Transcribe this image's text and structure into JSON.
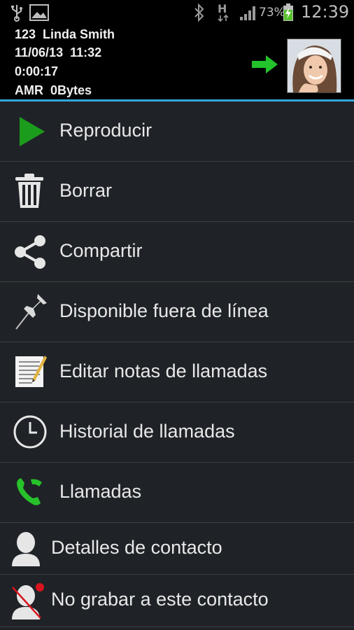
{
  "status_bar": {
    "icons": [
      "usb-icon",
      "gallery-icon",
      "bluetooth-icon",
      "h-data-icon",
      "signal-icon",
      "battery-charging-icon"
    ],
    "data_label": "H",
    "battery_percent": "73%",
    "time": "12:39"
  },
  "header": {
    "line1": "123  Linda Smith",
    "line2": "11/06/13  11:32",
    "line3": "0:00:17",
    "line4": "AMR  0Bytes",
    "arrow_color": "#22c32b"
  },
  "menu": {
    "items": [
      {
        "label": "Reproducir",
        "icon": "play-icon"
      },
      {
        "label": "Borrar",
        "icon": "trash-icon"
      },
      {
        "label": "Compartir",
        "icon": "share-icon"
      },
      {
        "label": "Disponible fuera de línea",
        "icon": "pin-icon"
      },
      {
        "label": "Editar notas de llamadas",
        "icon": "notes-icon"
      },
      {
        "label": "Historial de llamadas",
        "icon": "clock-icon"
      },
      {
        "label": "Llamadas",
        "icon": "phone-icon"
      },
      {
        "label": "Detalles de contacto",
        "icon": "contact-icon"
      },
      {
        "label": "No grabar a este contacto",
        "icon": "contact-no-record-icon"
      }
    ]
  },
  "colors": {
    "accent": "#35a7dd",
    "play_green": "#1c9c1c",
    "phone_green": "#27c22b",
    "record_red": "#d8141e"
  }
}
